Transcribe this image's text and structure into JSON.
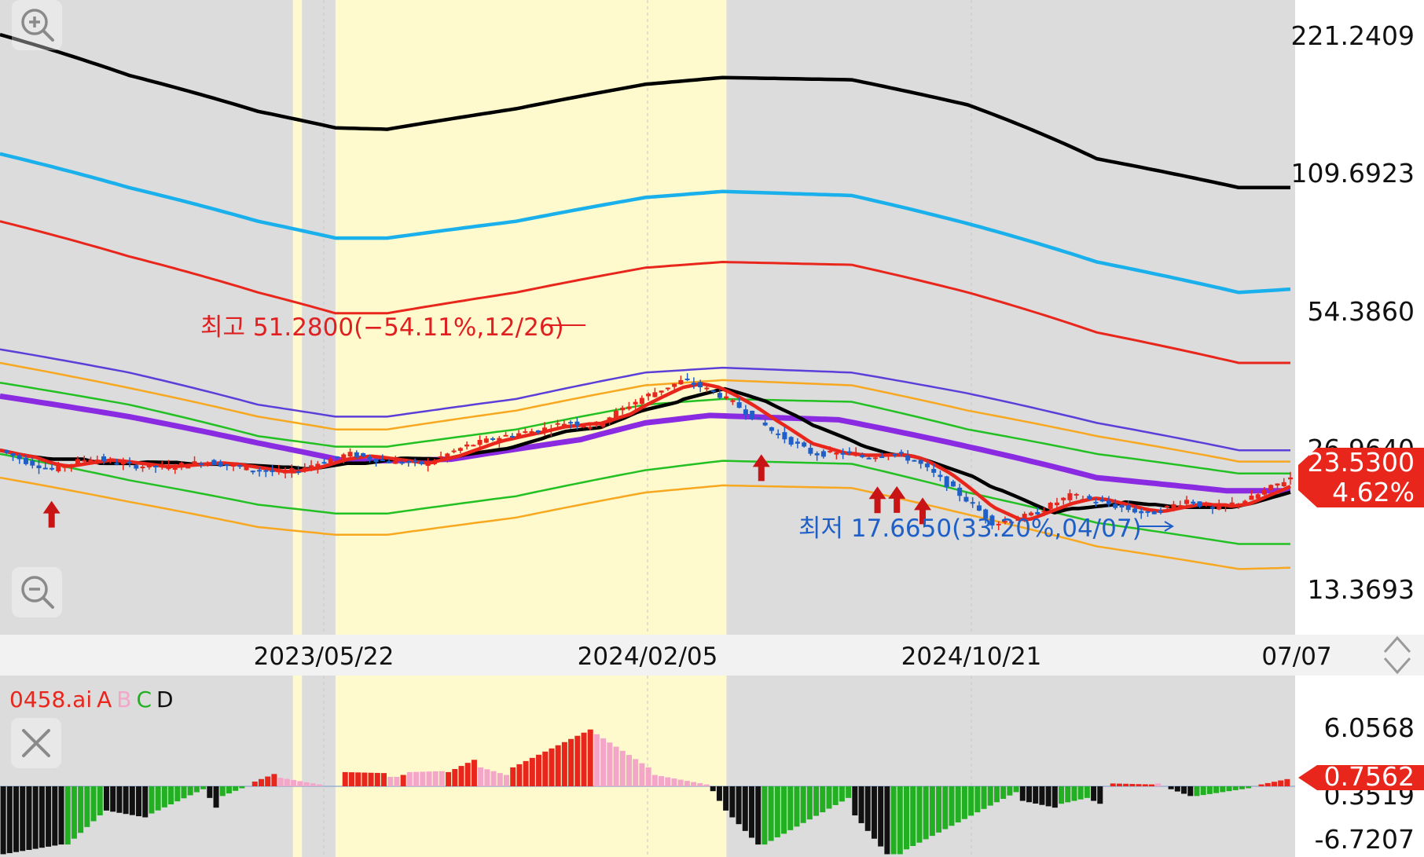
{
  "price_axis": {
    "labels": [
      "221.2409",
      "109.6923",
      "54.3860",
      "26.9640",
      "13.3693"
    ]
  },
  "current_price": {
    "value": "23.5300",
    "change": "4.62%",
    "color": "#e8261c"
  },
  "date_axis": {
    "labels": [
      "2023/05/22",
      "2024/02/05",
      "2024/10/21",
      "07/07"
    ]
  },
  "annotations": {
    "high": "최고 51.2800(−54.11%,12/26)",
    "low": "최저 17.6650(33.20%,04/07)"
  },
  "indicator": {
    "name": "0458.ai",
    "legend": [
      {
        "text": "A",
        "color": "#e8261c"
      },
      {
        "text": "B",
        "color": "#f4a6c8"
      },
      {
        "text": "C",
        "color": "#22b022"
      },
      {
        "text": "D",
        "color": "#111111"
      }
    ],
    "axis_labels": [
      "6.0568",
      "0.3519",
      "-6.7207"
    ],
    "current_value": "0.7562",
    "current_color": "#e8261c"
  },
  "icons": {
    "zoom_in": "zoom-in-icon",
    "zoom_out": "zoom-out-icon",
    "close": "close-icon",
    "scroll": "up-down-arrows-icon"
  },
  "colors": {
    "up_candle": "#e8261c",
    "down_candle": "#1f5fc8",
    "highlight_band": "#fffacd",
    "background_band": "#dcdcdc",
    "envelope_outer": "#000000",
    "envelope_2": "#1ab0ec",
    "envelope_3": "#e8261c",
    "envelope_4": "#5b3fd8",
    "envelope_5": "#f7a820",
    "envelope_6": "#22c022",
    "moving_average": "#8a2be2"
  },
  "chart_data": {
    "type": "line",
    "title": "",
    "y_scale": "log",
    "ylim": [
      13.3693,
      221.2409
    ],
    "x_tick_labels": [
      "2023/05/22",
      "2024/02/05",
      "2024/10/21",
      "07/07"
    ],
    "high": {
      "value": 51.28,
      "date": "12/26",
      "pct": -54.11
    },
    "low": {
      "value": 17.665,
      "date": "04/07",
      "pct": 33.2
    },
    "last_close": 23.53,
    "last_change_pct": 4.62,
    "envelopes": {
      "t": [
        0,
        0.1,
        0.2,
        0.26,
        0.3,
        0.4,
        0.5,
        0.56,
        0.66,
        0.75,
        0.85,
        0.96,
        1.0
      ],
      "series": [
        {
          "color": "#000000",
          "values": [
            221.24,
            180,
            150,
            138,
            137,
            152,
            172,
            178,
            176,
            155,
            118,
            102,
            102
          ]
        },
        {
          "color": "#1ab0ec",
          "values": [
            121,
            102,
            86,
            79,
            79,
            86,
            97,
            100,
            98,
            85,
            70,
            60,
            61
          ]
        },
        {
          "color": "#e8261c",
          "values": [
            86,
            72,
            60,
            54,
            54,
            60,
            68,
            70,
            69,
            60,
            49,
            42,
            42
          ]
        },
        {
          "color": "#5b3fd8",
          "values": [
            45,
            40,
            34,
            32,
            32,
            35,
            40,
            41,
            40,
            36,
            31,
            27,
            27
          ]
        },
        {
          "color": "#f7a820",
          "values": [
            42,
            37,
            32,
            30,
            30,
            33,
            37.5,
            38.5,
            37.5,
            33,
            29,
            25.5,
            25.5
          ]
        },
        {
          "color": "#22c022",
          "values": [
            38,
            34,
            29,
            27.5,
            27.5,
            30,
            34,
            35,
            34.5,
            30,
            26.5,
            24,
            24
          ]
        },
        {
          "color": "#22c022",
          "values": [
            26.5,
            23.2,
            20.5,
            19.6,
            19.6,
            21.4,
            24.4,
            25.6,
            25.2,
            21.8,
            18.7,
            16.8,
            16.8
          ]
        },
        {
          "color": "#f7a820",
          "values": [
            23.5,
            20.8,
            18.3,
            17.6,
            17.6,
            19.2,
            21.8,
            22.6,
            22.3,
            19.5,
            16.6,
            14.8,
            14.9
          ]
        }
      ]
    },
    "moving_average": {
      "color": "#8a2be2",
      "t": [
        0,
        0.1,
        0.2,
        0.27,
        0.35,
        0.45,
        0.5,
        0.55,
        0.65,
        0.75,
        0.85,
        0.95,
        1.0
      ],
      "values": [
        35.5,
        32,
        28,
        25.5,
        25.8,
        28.5,
        31,
        32.2,
        31.5,
        27.5,
        23.5,
        22,
        22
      ]
    },
    "price_path": {
      "t": [
        0,
        0.02,
        0.04,
        0.07,
        0.1,
        0.13,
        0.16,
        0.19,
        0.22,
        0.25,
        0.27,
        0.3,
        0.33,
        0.36,
        0.39,
        0.42,
        0.44,
        0.46,
        0.48,
        0.5,
        0.53,
        0.555,
        0.57,
        0.6,
        0.63,
        0.66,
        0.67,
        0.69,
        0.71,
        0.74,
        0.77,
        0.8,
        0.83,
        0.86,
        0.89,
        0.92,
        0.94,
        0.97,
        1.0
      ],
      "values": [
        27,
        25.5,
        24.5,
        26,
        25,
        24.8,
        25.5,
        24.6,
        24,
        25.5,
        26.5,
        25.5,
        25.2,
        27.5,
        29,
        30,
        31.2,
        30.5,
        33,
        35.5,
        38.5,
        36,
        34,
        29.5,
        26.5,
        26.6,
        26,
        26.7,
        25.5,
        22,
        18.6,
        19.5,
        21.5,
        20.5,
        19.5,
        21,
        20,
        21.2,
        23.53
      ]
    },
    "markers": [
      {
        "t": 0.04,
        "type": "buy-arrow"
      },
      {
        "t": 0.59,
        "type": "buy-arrow"
      },
      {
        "t": 0.68,
        "type": "buy-arrow"
      },
      {
        "t": 0.695,
        "type": "buy-arrow"
      },
      {
        "t": 0.715,
        "type": "buy-arrow"
      }
    ],
    "highlight_bands": [
      [
        0.227,
        0.234
      ],
      [
        0.26,
        0.563
      ]
    ],
    "oscillator": {
      "ylim": [
        -6.7207,
        6.0568
      ],
      "last": 0.7562,
      "segments": [
        {
          "from": 0,
          "to": 0.05,
          "start": -7,
          "end": -6,
          "up": "#111111",
          "down": "#111111"
        },
        {
          "from": 0.05,
          "to": 0.08,
          "start": -6,
          "end": -3,
          "up": "#22b022",
          "down": "#22b022"
        },
        {
          "from": 0.08,
          "to": 0.115,
          "start": -2.5,
          "end": -3.2,
          "up": "#111111",
          "down": "#111111"
        },
        {
          "from": 0.115,
          "to": 0.16,
          "start": -2.8,
          "end": -0.3,
          "up": "#22b022",
          "down": "#22b022"
        },
        {
          "from": 0.16,
          "to": 0.17,
          "start": -1.2,
          "end": -2.2,
          "up": "#111111",
          "down": "#111111"
        },
        {
          "from": 0.17,
          "to": 0.19,
          "start": -1.0,
          "end": -0.2,
          "up": "#22b022",
          "down": "#22b022"
        },
        {
          "from": 0.195,
          "to": 0.215,
          "start": 0.5,
          "end": 1.3,
          "up": "#e8261c",
          "down": "#e8261c"
        },
        {
          "from": 0.215,
          "to": 0.25,
          "start": 0.9,
          "end": 0.2,
          "up": "#f4a6c8",
          "down": "#f4a6c8"
        },
        {
          "from": 0.265,
          "to": 0.3,
          "start": 1.5,
          "end": 1.4,
          "up": "#e8261c",
          "down": "#e8261c"
        },
        {
          "from": 0.3,
          "to": 0.31,
          "start": 1.0,
          "end": 1.0,
          "up": "#f4a6c8",
          "down": "#f4a6c8"
        },
        {
          "from": 0.31,
          "to": 0.315,
          "start": 1.2,
          "end": 1.2,
          "up": "#e8261c",
          "down": "#e8261c"
        },
        {
          "from": 0.315,
          "to": 0.345,
          "start": 1.5,
          "end": 1.6,
          "up": "#f4a6c8",
          "down": "#f4a6c8"
        },
        {
          "from": 0.345,
          "to": 0.37,
          "start": 1.5,
          "end": 2.8,
          "up": "#e8261c",
          "down": "#e8261c"
        },
        {
          "from": 0.37,
          "to": 0.395,
          "start": 2.0,
          "end": 1.2,
          "up": "#f4a6c8",
          "down": "#f4a6c8"
        },
        {
          "from": 0.395,
          "to": 0.46,
          "start": 2.0,
          "end": 6.0,
          "up": "#e8261c",
          "down": "#e8261c"
        },
        {
          "from": 0.46,
          "to": 0.505,
          "start": 5.5,
          "end": 2.0,
          "up": "#f4a6c8",
          "down": "#f4a6c8"
        },
        {
          "from": 0.505,
          "to": 0.55,
          "start": 1.2,
          "end": 0.2,
          "up": "#f4a6c8",
          "down": "#f4a6c8"
        },
        {
          "from": 0.55,
          "to": 0.56,
          "start": -0.5,
          "end": -1.5,
          "up": "#111111",
          "down": "#111111"
        },
        {
          "from": 0.56,
          "to": 0.59,
          "start": -2.5,
          "end": -6.0,
          "up": "#111111",
          "down": "#111111"
        },
        {
          "from": 0.59,
          "to": 0.66,
          "start": -6.0,
          "end": -1.2,
          "up": "#22b022",
          "down": "#22b022"
        },
        {
          "from": 0.66,
          "to": 0.69,
          "start": -3.0,
          "end": -7.0,
          "up": "#111111",
          "down": "#111111"
        },
        {
          "from": 0.69,
          "to": 0.7,
          "start": -7.0,
          "end": -7.0,
          "up": "#22b022",
          "down": "#22b022"
        },
        {
          "from": 0.7,
          "to": 0.79,
          "start": -6.5,
          "end": -0.6,
          "up": "#22b022",
          "down": "#22b022"
        },
        {
          "from": 0.79,
          "to": 0.82,
          "start": -1.5,
          "end": -2.2,
          "up": "#111111",
          "down": "#111111"
        },
        {
          "from": 0.82,
          "to": 0.845,
          "start": -1.8,
          "end": -1.2,
          "up": "#22b022",
          "down": "#22b022"
        },
        {
          "from": 0.845,
          "to": 0.855,
          "start": -1.5,
          "end": -1.8,
          "up": "#111111",
          "down": "#111111"
        },
        {
          "from": 0.86,
          "to": 0.895,
          "start": 0.3,
          "end": 0.2,
          "up": "#e8261c",
          "down": "#e8261c"
        },
        {
          "from": 0.895,
          "to": 0.9,
          "start": 0.3,
          "end": 0.3,
          "up": "#f4a6c8",
          "down": "#f4a6c8"
        },
        {
          "from": 0.905,
          "to": 0.925,
          "start": -0.3,
          "end": -1.0,
          "up": "#111111",
          "down": "#111111"
        },
        {
          "from": 0.925,
          "to": 0.97,
          "start": -1.0,
          "end": -0.2,
          "up": "#22b022",
          "down": "#22b022"
        },
        {
          "from": 0.975,
          "to": 1.0,
          "start": 0.2,
          "end": 0.76,
          "up": "#e8261c",
          "down": "#e8261c"
        }
      ]
    }
  }
}
